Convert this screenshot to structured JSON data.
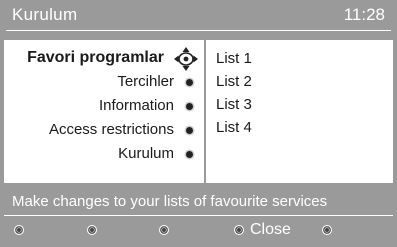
{
  "header": {
    "title": "Kurulum",
    "time": "11:28"
  },
  "menu": {
    "items": [
      {
        "label": "Favori programlar",
        "selected": true,
        "icon": "dpad-navigate-icon"
      },
      {
        "label": "Tercihler",
        "selected": false,
        "icon": "bullet-icon"
      },
      {
        "label": "Information",
        "selected": false,
        "icon": "bullet-icon"
      },
      {
        "label": "Access restrictions",
        "selected": false,
        "icon": "bullet-icon"
      },
      {
        "label": "Kurulum",
        "selected": false,
        "icon": "bullet-icon"
      }
    ]
  },
  "lists": {
    "items": [
      "List 1",
      "List 2",
      "List 3",
      "List 4"
    ]
  },
  "info": {
    "text": "Make changes to your lists of favourite services"
  },
  "buttons": {
    "items": [
      {
        "label": "",
        "color": "#ffffff"
      },
      {
        "label": "",
        "color": "#ffffff"
      },
      {
        "label": "",
        "color": "#ffffff"
      },
      {
        "label": "Close",
        "color": "#ffffff"
      },
      {
        "label": "",
        "color": "#ffffff"
      }
    ]
  },
  "colors": {
    "background": "#9a9a9a",
    "panel": "#ffffff",
    "text_dark": "#1a1a1a",
    "text_light": "#ffffff"
  }
}
